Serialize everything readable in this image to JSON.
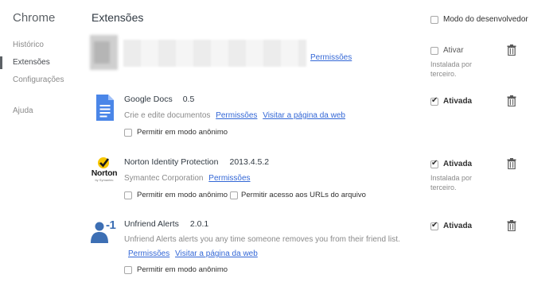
{
  "sidebar": {
    "brand": "Chrome",
    "items": [
      {
        "label": "Histórico"
      },
      {
        "label": "Extensões"
      },
      {
        "label": "Configurações"
      }
    ],
    "help": "Ajuda"
  },
  "header": {
    "title": "Extensões",
    "dev_mode_label": "Modo do desenvolvedor"
  },
  "extensions": [
    {
      "name": "",
      "permissions_link": "Permissões",
      "enable_label": "Ativar",
      "enabled": false,
      "installed_by": "Instalada por terceiro."
    },
    {
      "name": "Google Docs",
      "version": "0.5",
      "description": "Crie e edite documentos",
      "permissions_link": "Permissões",
      "web_link": "Visitar a página da web",
      "incognito_label": "Permitir em modo anônimo",
      "enable_label": "Ativada",
      "enabled": true
    },
    {
      "name": "Norton Identity Protection",
      "version": "2013.4.5.2",
      "description": "Symantec Corporation",
      "permissions_link": "Permissões",
      "incognito_label": "Permitir em modo anônimo",
      "file_urls_label": "Permitir acesso aos URLs do arquivo",
      "enable_label": "Ativada",
      "enabled": true,
      "installed_by": "Instalada por terceiro.",
      "icon_text": "Norton",
      "icon_subtext": "by Symantec"
    },
    {
      "name": "Unfriend Alerts",
      "version": "2.0.1",
      "description": "Unfriend Alerts alerts you any time someone removes you from their friend list.",
      "permissions_link": "Permissões",
      "web_link": "Visitar a página da web",
      "incognito_label": "Permitir em modo anônimo",
      "enable_label": "Ativada",
      "enabled": true,
      "icon_text": "-1"
    }
  ],
  "colors": {
    "link": "#3367d6",
    "docs_blue": "#4a86e8",
    "norton_yellow": "#f7c600",
    "unfriend_blue": "#3d6fb4"
  }
}
